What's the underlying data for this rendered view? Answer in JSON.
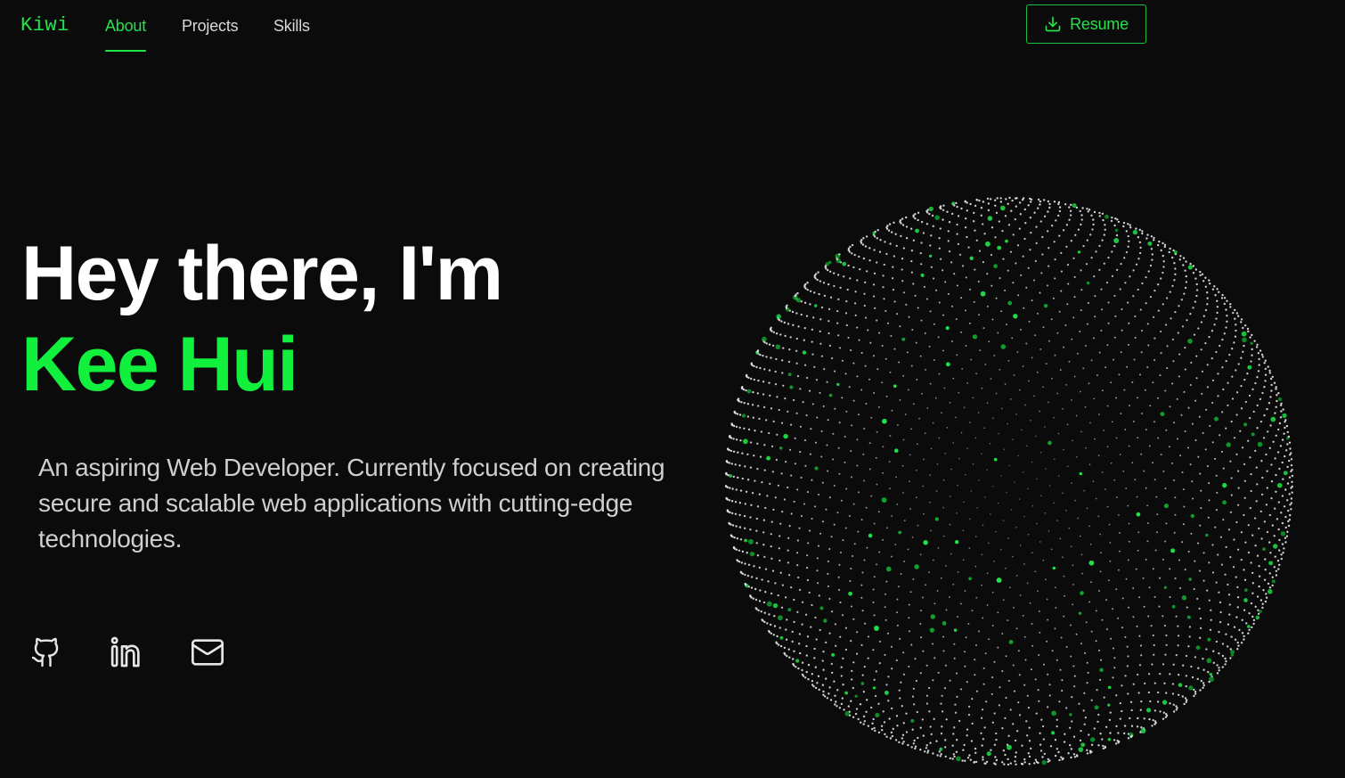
{
  "nav": {
    "brand": "Kiwi",
    "items": [
      {
        "label": "About",
        "active": true
      },
      {
        "label": "Projects",
        "active": false
      },
      {
        "label": "Skills",
        "active": false
      }
    ],
    "resume_label": "Resume",
    "resume_icon": "download-icon"
  },
  "hero": {
    "greeting": "Hey there, I'm",
    "name": "Kee Hui",
    "tagline": "An aspiring Web Developer. Currently focused on creating secure and scalable web applications with cutting-edge technologies."
  },
  "social": [
    {
      "name": "github-icon"
    },
    {
      "name": "linkedin-icon"
    },
    {
      "name": "mail-icon"
    }
  ],
  "colors": {
    "background": "#0b0b0b",
    "accent": "#22e34a",
    "name_green": "#12f03e",
    "text": "#ffffff",
    "muted_text": "#cfcfcf"
  }
}
